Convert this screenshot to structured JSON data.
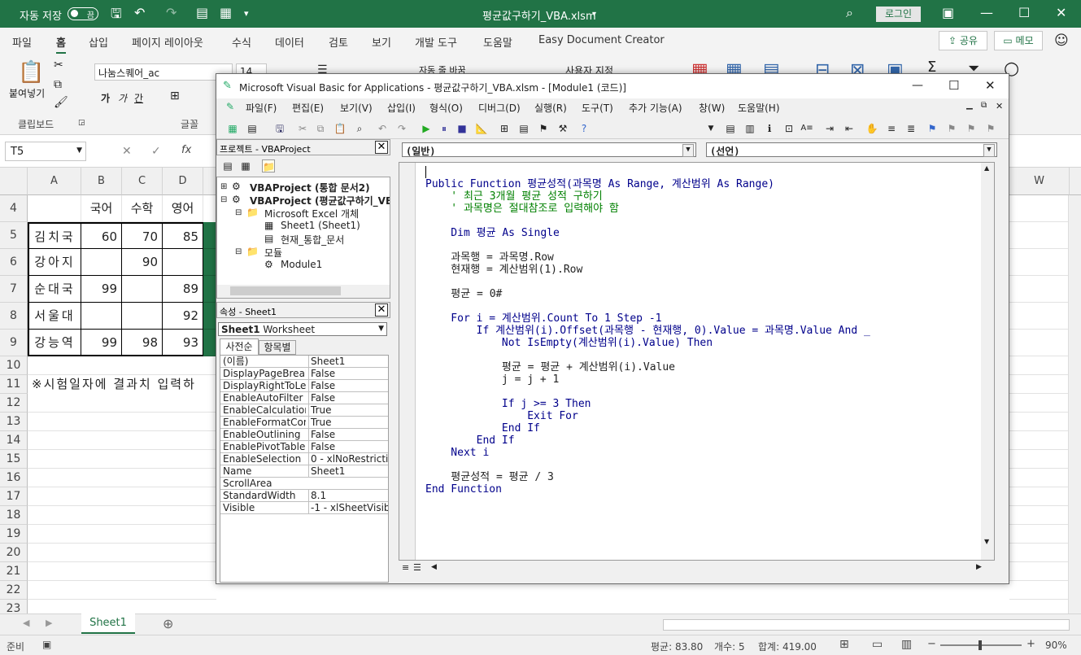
{
  "excel": {
    "autosave_label": "자동 저장",
    "autosave_state": "끔",
    "file_title": "평균값구하기_VBA.xlsm",
    "login_label": "로그인",
    "tabs": [
      "파일",
      "홈",
      "삽입",
      "페이지 레이아웃",
      "수식",
      "데이터",
      "검토",
      "보기",
      "개발 도구",
      "도움말",
      "Easy Document Creator"
    ],
    "share_label": "공유",
    "memo_label": "메모",
    "ribbon": {
      "paste_label": "붙여넣기",
      "clipboard_label": "클립보드",
      "font_group_label": "글꼴",
      "font_name": "나눔스퀘어_ac",
      "font_size": "14",
      "wrap_label": "자동 줄 바꿈",
      "number_format": "사용자 지정"
    },
    "name_box": "T5",
    "fx_label": "fx",
    "columns": [
      "A",
      "B",
      "C",
      "D"
    ],
    "col_w": "W",
    "rows": [
      "4",
      "5",
      "6",
      "7",
      "8",
      "9",
      "10",
      "11",
      "12",
      "13",
      "14",
      "15",
      "16",
      "17",
      "18",
      "19",
      "20",
      "21",
      "22",
      "23"
    ],
    "header_row": [
      "국어",
      "수학",
      "영어"
    ],
    "data_rows": [
      {
        "name": "김치국",
        "b": "60",
        "c": "70",
        "d": "85"
      },
      {
        "name": "강아지",
        "b": "",
        "c": "90",
        "d": ""
      },
      {
        "name": "순대국",
        "b": "99",
        "c": "",
        "d": "89"
      },
      {
        "name": "서울대",
        "b": "",
        "c": "",
        "d": "92"
      },
      {
        "name": "강능역",
        "b": "99",
        "c": "98",
        "d": "93"
      }
    ],
    "note_row11": "※시험일자에 결과치 입력하",
    "sheet_tab": "Sheet1",
    "status_ready": "준비",
    "status_avg": "평균: 83.80",
    "status_count": "개수: 5",
    "status_sum": "합계: 419.00",
    "zoom": "90%",
    "colors": {
      "accent": "#217346",
      "selection": "#217346"
    }
  },
  "vbe": {
    "title": "Microsoft Visual Basic for Applications - 평균값구하기_VBA.xlsm - [Module1 (코드)]",
    "menu": [
      "파일(F)",
      "편집(E)",
      "보기(V)",
      "삽입(I)",
      "형식(O)",
      "디버그(D)",
      "실행(R)",
      "도구(T)",
      "추가 기능(A)",
      "창(W)",
      "도움말(H)"
    ],
    "project_title": "프로젝트 - VBAProject",
    "tree": {
      "p1": "VBAProject (통합 문서2)",
      "p2": "VBAProject (평균값구하기_VBA.xlsm)",
      "excel_objects": "Microsoft Excel 개체",
      "sheet1": "Sheet1 (Sheet1)",
      "thisworkbook": "현재_통합_문서",
      "modules": "모듈",
      "module1": "Module1"
    },
    "props_title": "속성 - Sheet1",
    "props_object": "Sheet1",
    "props_type": "Worksheet",
    "props_tab1": "사전순",
    "props_tab2": "항목별",
    "props": [
      {
        "k": "(이름)",
        "v": "Sheet1"
      },
      {
        "k": "DisplayPageBreak",
        "v": "False"
      },
      {
        "k": "DisplayRightToLef",
        "v": "False"
      },
      {
        "k": "EnableAutoFilter",
        "v": "False"
      },
      {
        "k": "EnableCalculation",
        "v": "True"
      },
      {
        "k": "EnableFormatCon",
        "v": "True"
      },
      {
        "k": "EnableOutlining",
        "v": "False"
      },
      {
        "k": "EnablePivotTable",
        "v": "False"
      },
      {
        "k": "EnableSelection",
        "v": "0 - xlNoRestrictio"
      },
      {
        "k": "Name",
        "v": "Sheet1"
      },
      {
        "k": "ScrollArea",
        "v": ""
      },
      {
        "k": "StandardWidth",
        "v": "8.1"
      },
      {
        "k": "Visible",
        "v": "-1 - xlSheetVisib"
      }
    ],
    "combo_object": "(일반)",
    "combo_proc": "(선언)",
    "code_lines": [
      "",
      "Public Function 평균성적(과목명 As Range, 계산범위 As Range)",
      "    ' 최근 3개월 평균 성적 구하기",
      "    ' 과목명은 절대참조로 입력해야 함",
      "",
      "    Dim 평균 As Single",
      "",
      "    과목행 = 과목명.Row",
      "    현재행 = 계산범위(1).Row",
      "",
      "    평균 = 0#",
      "",
      "    For i = 계산범위.Count To 1 Step -1",
      "        If 계산범위(i).Offset(과목행 - 현재행, 0).Value = 과목명.Value And _",
      "            Not IsEmpty(계산범위(i).Value) Then",
      "",
      "            평균 = 평균 + 계산범위(i).Value",
      "            j = j + 1",
      "",
      "            If j >= 3 Then",
      "                Exit For",
      "            End If",
      "        End If",
      "    Next i",
      "",
      "    평균성적 = 평균 / 3",
      "End Function"
    ]
  }
}
